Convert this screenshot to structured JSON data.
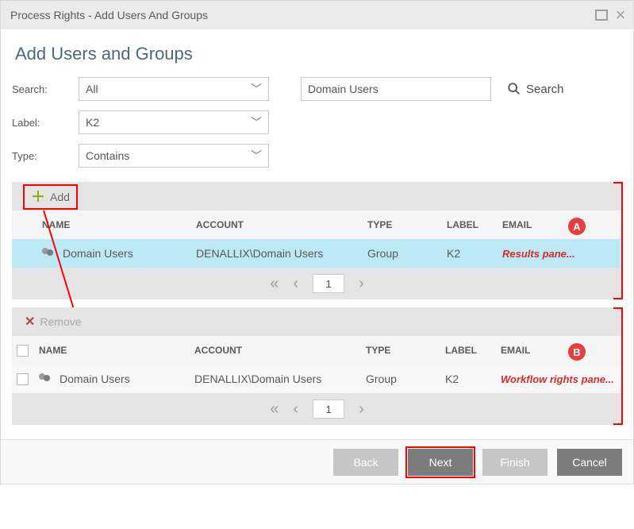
{
  "titlebar": {
    "title": "Process Rights - Add Users And Groups"
  },
  "heading": "Add Users and Groups",
  "filters": {
    "search_label": "Search:",
    "search_value": "All",
    "label_label": "Label:",
    "label_value": "K2",
    "type_label": "Type:",
    "type_value": "Contains",
    "query_value": "Domain Users",
    "search_button": "Search"
  },
  "results": {
    "toolbar_add": "Add",
    "columns": {
      "name": "NAME",
      "account": "ACCOUNT",
      "type": "TYPE",
      "label": "LABEL",
      "email": "EMAIL"
    },
    "rows": [
      {
        "name": "Domain Users",
        "account": "DENALLIX\\Domain Users",
        "type": "Group",
        "label": "K2",
        "email": ""
      }
    ],
    "annotation": "Results pane...",
    "badge": "A",
    "page": "1"
  },
  "selected": {
    "toolbar_remove": "Remove",
    "columns": {
      "name": "NAME",
      "account": "ACCOUNT",
      "type": "TYPE",
      "label": "LABEL",
      "email": "EMAIL"
    },
    "rows": [
      {
        "name": "Domain Users",
        "account": "DENALLIX\\Domain Users",
        "type": "Group",
        "label": "K2",
        "email": ""
      }
    ],
    "annotation": "Workflow rights pane...",
    "badge": "B",
    "page": "1"
  },
  "footer": {
    "back": "Back",
    "next": "Next",
    "finish": "Finish",
    "cancel": "Cancel"
  }
}
